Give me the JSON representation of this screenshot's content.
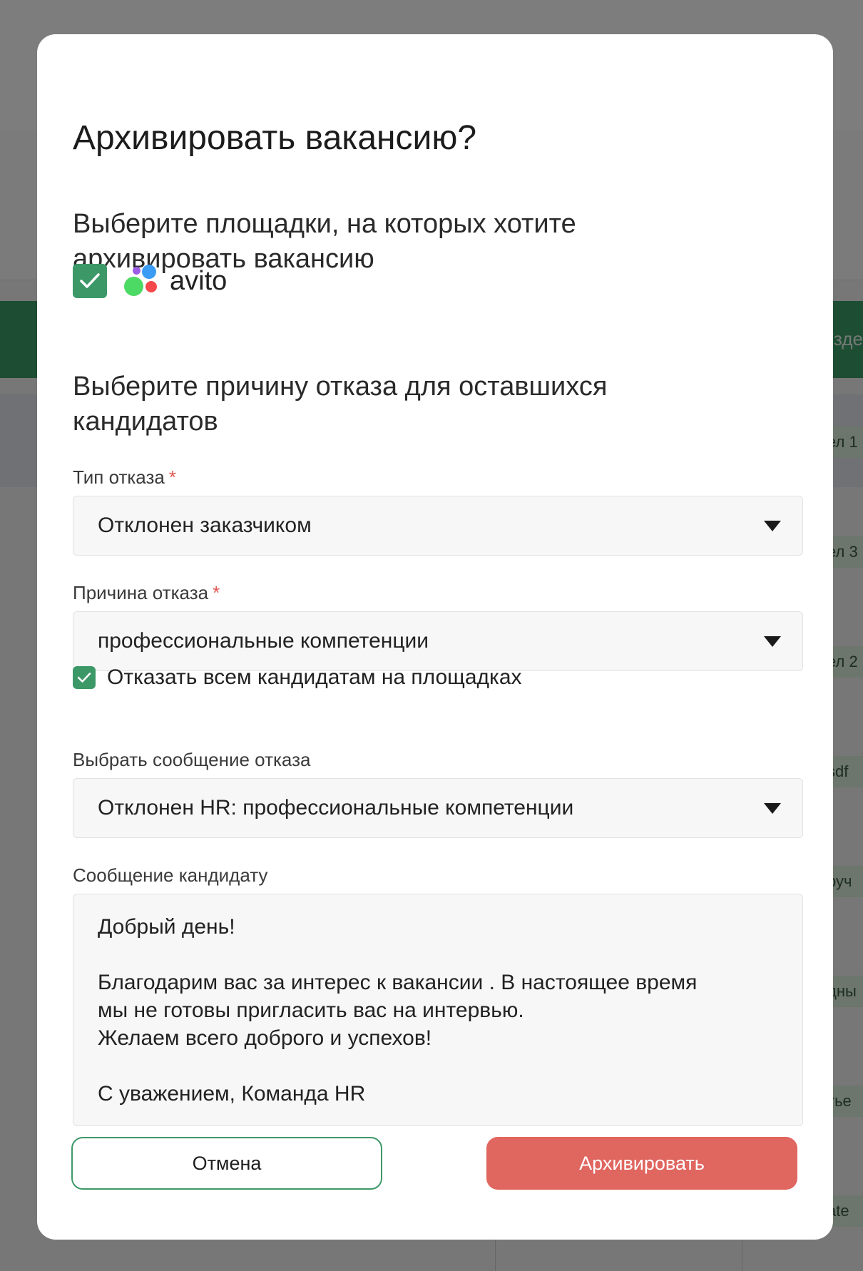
{
  "dialog": {
    "title": "Архивировать вакансию?",
    "platforms_heading": "Выберите площадки, на которых хотите архивировать вакансию",
    "platforms": [
      {
        "name": "avito",
        "checked": true
      }
    ],
    "reason_heading": "Выберите причину отказа для оставшихся кандидатов",
    "reject_type": {
      "label": "Тип отказа",
      "required_mark": "*",
      "value": "Отклонен заказчиком"
    },
    "reject_reason": {
      "label": "Причина отказа",
      "required_mark": "*",
      "value": "профессиональные компетенции"
    },
    "reject_all": {
      "label": "Отказать всем кандидатам на площадках",
      "checked": true
    },
    "message_select": {
      "label": "Выбрать сообщение отказа",
      "value": "Отклонен HR: профессиональные компетенции"
    },
    "candidate_message": {
      "label": "Сообщение кандидату",
      "lines": [
        "Добрый день!",
        "",
        "Благодарим вас за интерес к вакансии . В настоящее время",
        "мы не готовы пригласить вас на интервью.",
        "Желаем всего доброго и успехов!",
        "",
        "С уважением, Команда HR"
      ]
    },
    "buttons": {
      "cancel": "Отмена",
      "archive": "Архивировать"
    }
  },
  "background": {
    "green_bar_text": "зде",
    "right_cells": [
      "ел 1",
      "ел 3",
      "ел 2",
      "sdf",
      "руч",
      "дны",
      "тье",
      "ate"
    ]
  },
  "colors": {
    "accent_green": "#3d9868",
    "danger_red": "#e06660",
    "required_red": "#e0574f",
    "avito_purple": "#9b5de5",
    "avito_blue": "#3b9cf5",
    "avito_green": "#4cd964",
    "avito_red": "#f5484b"
  }
}
